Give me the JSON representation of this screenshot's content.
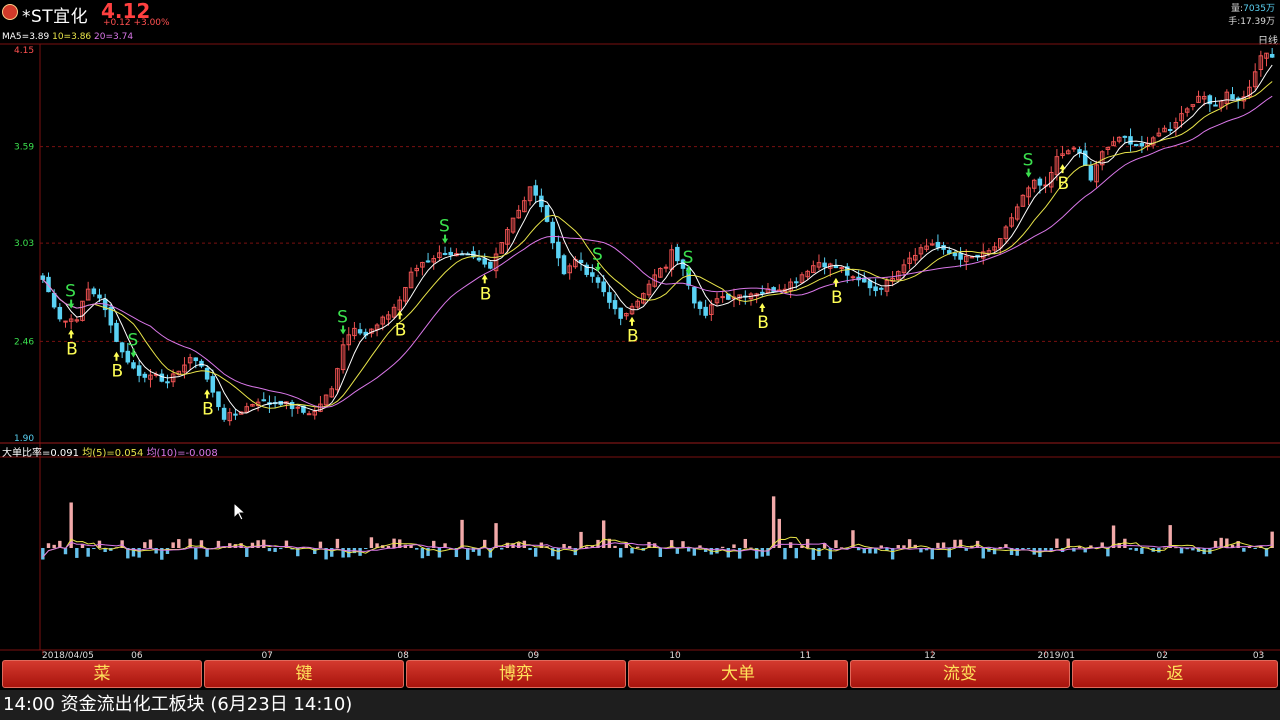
{
  "header": {
    "name": "*ST宜化",
    "price": "4.12",
    "change": "+0.12 +3.00%",
    "volume_label": "量:",
    "volume_value": "7035万",
    "hands_label": "手:",
    "hands_value": "17.39万",
    "period": "日线"
  },
  "legend": {
    "ma5": "MA5=3.89",
    "ma10": "10=3.86",
    "ma20": "20=3.74",
    "indicator_name": "大单比率=0.091",
    "indicator_avg5": "均(5)=0.054",
    "indicator_avg10": "均(10)=-0.008"
  },
  "colors": {
    "up": "#ee5252",
    "down": "#5ad2f4",
    "ma5": "#ffffff",
    "ma10": "#e8e44a",
    "ma20": "#d977e8",
    "grid": "#7a1010",
    "signal_b": "#ffff55",
    "signal_s": "#3be04e",
    "bar_up": "#f2a9a9",
    "bar_down": "#66c0ea"
  },
  "menu": [
    "菜",
    "键",
    "博弈",
    "大单",
    "流变",
    "返"
  ],
  "status": "14:00 资金流出化工板块 (6月23日 14:10)",
  "chart_data": {
    "type": "candlestick",
    "title": "*ST宜化 日线",
    "ylim": [
      1.9,
      4.15
    ],
    "y_ticks": [
      "4.15",
      "3.59",
      "3.03",
      "2.46",
      "1.90"
    ],
    "x_ticks": [
      {
        "label": "2018/04/05",
        "index": 0
      },
      {
        "label": "06",
        "index": 17
      },
      {
        "label": "07",
        "index": 40
      },
      {
        "label": "08",
        "index": 64
      },
      {
        "label": "09",
        "index": 87
      },
      {
        "label": "10",
        "index": 112
      },
      {
        "label": "11",
        "index": 135
      },
      {
        "label": "12",
        "index": 157
      },
      {
        "label": "2019/01",
        "index": 177
      },
      {
        "label": "02",
        "index": 198
      },
      {
        "label": "03",
        "index": 215
      }
    ],
    "close_path": [
      [
        0,
        2.82
      ],
      [
        3,
        2.6
      ],
      [
        4,
        2.58
      ],
      [
        6,
        2.6
      ],
      [
        8,
        2.76
      ],
      [
        10,
        2.72
      ],
      [
        12,
        2.55
      ],
      [
        14,
        2.4
      ],
      [
        16,
        2.3
      ],
      [
        18,
        2.25
      ],
      [
        20,
        2.28
      ],
      [
        22,
        2.21
      ],
      [
        24,
        2.3
      ],
      [
        26,
        2.35
      ],
      [
        27,
        2.36
      ],
      [
        28,
        2.32
      ],
      [
        30,
        2.16
      ],
      [
        32,
        2.02
      ],
      [
        34,
        2.04
      ],
      [
        36,
        2.08
      ],
      [
        38,
        2.12
      ],
      [
        40,
        2.1
      ],
      [
        42,
        2.11
      ],
      [
        44,
        2.08
      ],
      [
        46,
        2.05
      ],
      [
        48,
        2.05
      ],
      [
        49,
        2.1
      ],
      [
        51,
        2.18
      ],
      [
        53,
        2.45
      ],
      [
        55,
        2.55
      ],
      [
        57,
        2.5
      ],
      [
        59,
        2.55
      ],
      [
        61,
        2.62
      ],
      [
        63,
        2.7
      ],
      [
        65,
        2.85
      ],
      [
        67,
        2.92
      ],
      [
        69,
        2.95
      ],
      [
        71,
        2.98
      ],
      [
        73,
        2.96
      ],
      [
        75,
        2.95
      ],
      [
        77,
        2.92
      ],
      [
        79,
        2.88
      ],
      [
        81,
        3.05
      ],
      [
        83,
        3.18
      ],
      [
        85,
        3.28
      ],
      [
        86,
        3.35
      ],
      [
        88,
        3.25
      ],
      [
        89,
        3.14
      ],
      [
        90,
        3.05
      ],
      [
        92,
        2.85
      ],
      [
        94,
        2.95
      ],
      [
        96,
        2.85
      ],
      [
        98,
        2.8
      ],
      [
        100,
        2.7
      ],
      [
        102,
        2.58
      ],
      [
        104,
        2.68
      ],
      [
        106,
        2.73
      ],
      [
        108,
        2.84
      ],
      [
        110,
        2.9
      ],
      [
        111,
        2.98
      ],
      [
        113,
        2.9
      ],
      [
        115,
        2.7
      ],
      [
        117,
        2.6
      ],
      [
        119,
        2.72
      ],
      [
        121,
        2.72
      ],
      [
        123,
        2.73
      ],
      [
        125,
        2.74
      ],
      [
        127,
        2.75
      ],
      [
        129,
        2.76
      ],
      [
        131,
        2.78
      ],
      [
        133,
        2.82
      ],
      [
        135,
        2.88
      ],
      [
        137,
        2.92
      ],
      [
        139,
        2.9
      ],
      [
        141,
        2.88
      ],
      [
        143,
        2.82
      ],
      [
        145,
        2.8
      ],
      [
        147,
        2.76
      ],
      [
        149,
        2.8
      ],
      [
        151,
        2.88
      ],
      [
        153,
        2.95
      ],
      [
        155,
        3.0
      ],
      [
        157,
        3.03
      ],
      [
        159,
        2.98
      ],
      [
        161,
        2.96
      ],
      [
        163,
        2.94
      ],
      [
        165,
        2.95
      ],
      [
        167,
        2.98
      ],
      [
        169,
        3.04
      ],
      [
        171,
        3.18
      ],
      [
        173,
        3.3
      ],
      [
        175,
        3.38
      ],
      [
        177,
        3.35
      ],
      [
        179,
        3.52
      ],
      [
        181,
        3.58
      ],
      [
        183,
        3.55
      ],
      [
        185,
        3.4
      ],
      [
        187,
        3.55
      ],
      [
        189,
        3.62
      ],
      [
        191,
        3.64
      ],
      [
        193,
        3.6
      ],
      [
        195,
        3.59
      ],
      [
        197,
        3.68
      ],
      [
        199,
        3.7
      ],
      [
        201,
        3.78
      ],
      [
        203,
        3.85
      ],
      [
        205,
        3.88
      ],
      [
        207,
        3.83
      ],
      [
        209,
        3.9
      ],
      [
        211,
        3.85
      ],
      [
        213,
        3.92
      ],
      [
        215,
        4.12
      ]
    ],
    "series": [
      {
        "name": "MA5",
        "value": 3.89
      },
      {
        "name": "10",
        "value": 3.86
      },
      {
        "name": "20",
        "value": 3.74
      }
    ],
    "signals": [
      {
        "type": "S",
        "index": 5
      },
      {
        "type": "B",
        "index": 5
      },
      {
        "type": "B",
        "index": 13
      },
      {
        "type": "S",
        "index": 16
      },
      {
        "type": "B",
        "index": 29
      },
      {
        "type": "S",
        "index": 53
      },
      {
        "type": "B",
        "index": 63
      },
      {
        "type": "S",
        "index": 71
      },
      {
        "type": "B",
        "index": 78
      },
      {
        "type": "S",
        "index": 98
      },
      {
        "type": "B",
        "index": 104
      },
      {
        "type": "S",
        "index": 114
      },
      {
        "type": "B",
        "index": 127
      },
      {
        "type": "B",
        "index": 140
      },
      {
        "type": "S",
        "index": 174
      },
      {
        "type": "B",
        "index": 180
      }
    ],
    "indicator": {
      "name": "大单比率",
      "value": 0.091,
      "avg5": 0.054,
      "avg10": -0.008
    }
  }
}
